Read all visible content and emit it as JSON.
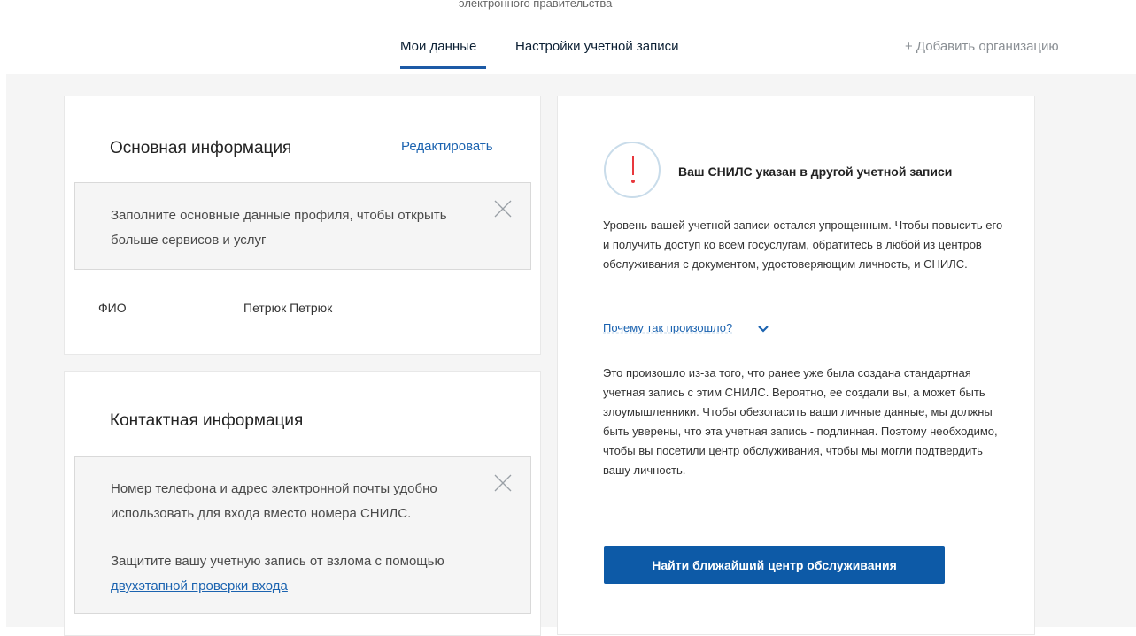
{
  "header": {
    "clipped_text": "электронного правительства",
    "tabs": [
      {
        "label": "Мои данные",
        "active": true
      },
      {
        "label": "Настройки учетной записи",
        "active": false
      }
    ],
    "add_org": "+ Добавить организацию"
  },
  "basic_info": {
    "title": "Основная информация",
    "edit_label": "Редактировать",
    "notice": "Заполните основные данные профиля, чтобы открыть больше сервисов и услуг",
    "field_label": "ФИО",
    "field_value": "Петрюк Петрюк"
  },
  "contact_info": {
    "title": "Контактная информация",
    "notice": "Номер телефона и адрес электронной почты удобно использовать для входа вместо номера СНИЛС.",
    "notice2_prefix": "Защитите вашу учетную запись от взлома с помощью",
    "notice2_link": "двухэтапной проверки входа"
  },
  "snils_warning": {
    "heading": "Ваш СНИЛС указан в другой учетной записи",
    "paragraph1": "Уровень вашей учетной записи остался упрощенным. Чтобы повысить его и получить доступ ко всем госуслугам, обратитесь в любой из центров обслуживания с документом, удостоверяющим личность, и СНИЛС.",
    "why_link": "Почему так произошло?",
    "paragraph2": "Это произошло из-за того, что ранее уже была создана стандартная учетная запись с этим СНИЛС. Вероятно, ее создали вы, а может быть злоумышленники. Чтобы обезопасить ваши личные данные, мы должны быть уверены, что эта учетная запись - подлинная. Поэтому необходимо, чтобы вы посетили центр обслуживания, чтобы мы могли подтвердить вашу личность.",
    "button_label": "Найти ближайший центр обслуживания"
  },
  "icons": {
    "warning": "exclamation-circle-icon",
    "close": "close-icon",
    "chevron": "chevron-down-icon"
  },
  "colors": {
    "accent": "#1b63b0",
    "button": "#0d5aa7",
    "warning_red": "#e8383d",
    "background": "#f5f5f5"
  }
}
